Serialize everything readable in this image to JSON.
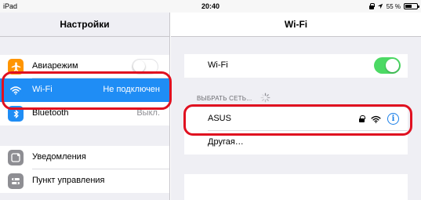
{
  "status_bar": {
    "device": "iPad",
    "time": "20:40",
    "battery": "55 %",
    "battery_level": 0.55,
    "icons": [
      "lock-icon",
      "location-arrow-icon",
      "battery-icon"
    ]
  },
  "left_panel": {
    "title": "Настройки",
    "items": [
      {
        "label": "Авиарежим",
        "icon": "airplane-icon",
        "icon_color": "#ff9500",
        "toggle": "off"
      },
      {
        "label": "Wi-Fi",
        "value": "Не подключен",
        "icon": "wifi-icon",
        "icon_color": "#1f8df5",
        "selected": true
      },
      {
        "label": "Bluetooth",
        "value": "Выкл.",
        "icon": "bluetooth-icon",
        "icon_color": "#1f8df5"
      },
      {
        "label": "Уведомления",
        "icon": "notifications-icon",
        "icon_color": "#8e8e93"
      },
      {
        "label": "Пункт управления",
        "icon": "control-center-icon",
        "icon_color": "#8e8e93"
      }
    ]
  },
  "right_panel": {
    "title": "Wi-Fi",
    "wifi_toggle_label": "Wi-Fi",
    "wifi_toggle_state": "on",
    "section_header": "ВЫБРАТЬ СЕТЬ...",
    "networks": [
      {
        "name": "ASUS",
        "secured": true
      }
    ],
    "other_label": "Другая…"
  },
  "colors": {
    "accent": "#1f8df5",
    "highlight": "#e01020",
    "toggle_on": "#4cd964",
    "background": "#efeff4"
  }
}
